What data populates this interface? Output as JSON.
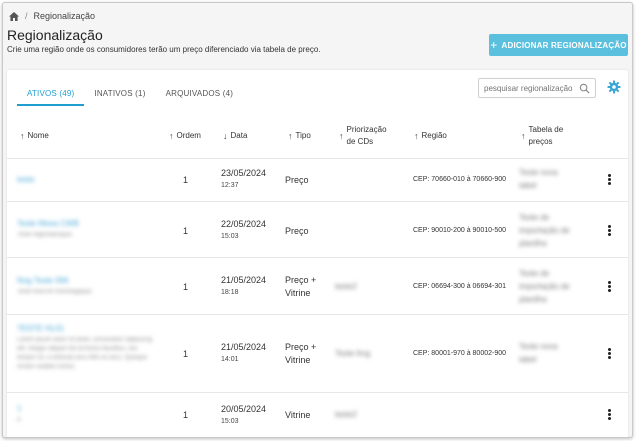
{
  "breadcrumb": {
    "separator": "/",
    "current": "Regionalização"
  },
  "header": {
    "title": "Regionalização",
    "subtitle": "Crie uma região onde os consumidores terão um preço diferenciado via tabela de preço.",
    "add_button": "ADICIONAR REGIONALIZAÇÃO"
  },
  "tabs": [
    {
      "label": "ATIVOS (49)",
      "active": true
    },
    {
      "label": "INATIVOS (1)",
      "active": false
    },
    {
      "label": "ARQUIVADOS (4)",
      "active": false
    }
  ],
  "search": {
    "placeholder": "pesquisar regionalização"
  },
  "columns": {
    "nome": "Nome",
    "ordem": "Ordem",
    "data": "Data",
    "tipo": "Tipo",
    "priorizacao_1": "Priorização",
    "priorizacao_2": "de CDs",
    "regiao": "Região",
    "tabela_1": "Tabela de",
    "tabela_2": "preços"
  },
  "rows": [
    {
      "name": "teste",
      "sub": "",
      "ordem": "1",
      "date": "23/05/2024",
      "time": "12:37",
      "tipo1": "Preço",
      "tipo2": "",
      "priorizacao": "",
      "regiao": "CEP: 70660-010 à 70660-900",
      "tabela1": "Teste nova",
      "tabela2": "tabel",
      "tabela3": ""
    },
    {
      "name": "Teste Mesa CWB",
      "sub": "Teste regionalização",
      "ordem": "1",
      "date": "22/05/2024",
      "time": "15:03",
      "tipo1": "Preço",
      "tipo2": "",
      "priorizacao": "",
      "regiao": "CEP: 90010-200 à 90010-500",
      "tabela1": "Teste de",
      "tabela2": "importação de",
      "tabela3": "planilha"
    },
    {
      "name": "Nog Teste 066",
      "sub": "Teste final em homologação",
      "ordem": "1",
      "date": "21/05/2024",
      "time": "18:18",
      "tipo1": "Preço +",
      "tipo2": "Vitrine",
      "priorizacao": "teste2",
      "regiao": "CEP: 06694-300 à 06694-301",
      "tabela1": "Teste de",
      "tabela2": "importação de",
      "tabela3": "planilha"
    },
    {
      "name": "TESTE HL01",
      "sub": "Lorem ipsum dolor sit amet, consectetur adipiscing elit. Integer aliquet nisl at lectus faucibus, nec tempor mi, a vehicula arcu felis eu arcu. Quisque ornare sodales luctus.",
      "ordem": "1",
      "date": "21/05/2024",
      "time": "14:01",
      "tipo1": "Preço +",
      "tipo2": "Vitrine",
      "priorizacao": "Teste Ang",
      "regiao": "CEP: 80001-970 à 80002-900",
      "tabela1": "Teste nova",
      "tabela2": "tabel",
      "tabela3": ""
    },
    {
      "name": "1",
      "sub": "a",
      "ordem": "1",
      "date": "20/05/2024",
      "time": "15:03",
      "tipo1": "Vitrine",
      "tipo2": "",
      "priorizacao": "teste2",
      "regiao": "",
      "tabela1": "",
      "tabela2": "",
      "tabela3": ""
    }
  ]
}
